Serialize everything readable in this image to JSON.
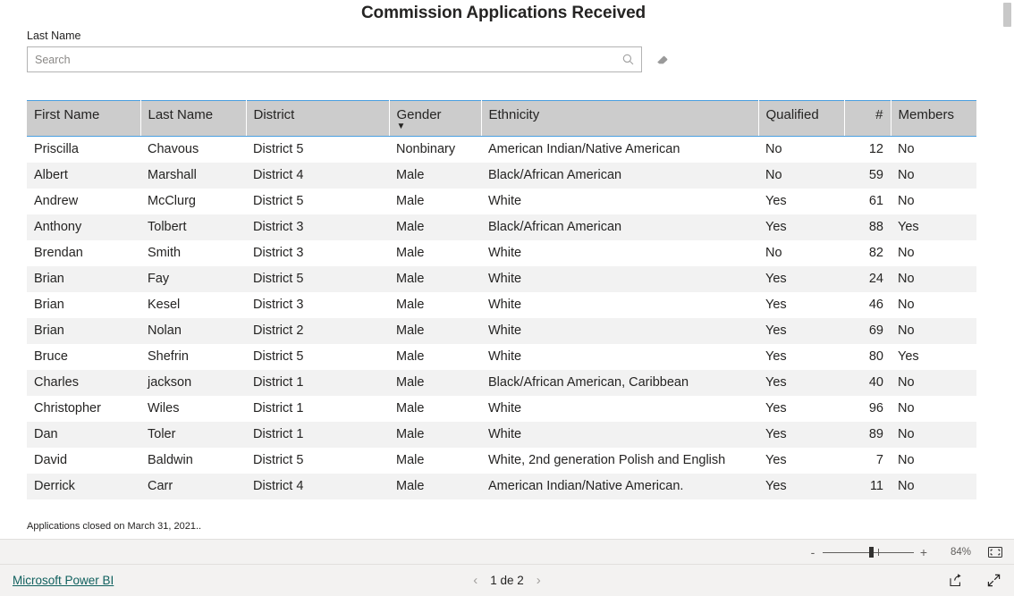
{
  "report": {
    "title": "Commission Applications Received",
    "footnote": "Applications closed on March 31, 2021.."
  },
  "slicer": {
    "label": "Last Name",
    "placeholder": "Search",
    "value": "",
    "search_icon": "search-icon",
    "clear_icon": "eraser-icon"
  },
  "table": {
    "columns": [
      {
        "key": "first_name",
        "label": "First Name",
        "align": "left",
        "sorted": false
      },
      {
        "key": "last_name",
        "label": "Last Name",
        "align": "left",
        "sorted": false
      },
      {
        "key": "district",
        "label": "District",
        "align": "left",
        "sorted": false
      },
      {
        "key": "gender",
        "label": "Gender",
        "align": "left",
        "sorted": true,
        "sort_direction": "desc",
        "sort_glyph": "▼"
      },
      {
        "key": "ethnicity",
        "label": "Ethnicity",
        "align": "left",
        "sorted": false
      },
      {
        "key": "qualified",
        "label": "Qualified",
        "align": "left",
        "sorted": false
      },
      {
        "key": "number",
        "label": "#",
        "align": "right",
        "sorted": false
      },
      {
        "key": "members",
        "label": "Members",
        "align": "left",
        "sorted": false
      }
    ],
    "rows": [
      {
        "first_name": "Priscilla",
        "last_name": "Chavous",
        "district": "District 5",
        "gender": "Nonbinary",
        "ethnicity": "American Indian/Native American",
        "qualified": "No",
        "number": "12",
        "members": "No"
      },
      {
        "first_name": "Albert",
        "last_name": "Marshall",
        "district": "District 4",
        "gender": "Male",
        "ethnicity": "Black/African American",
        "qualified": "No",
        "number": "59",
        "members": "No"
      },
      {
        "first_name": "Andrew",
        "last_name": "McClurg",
        "district": "District 5",
        "gender": "Male",
        "ethnicity": "White",
        "qualified": "Yes",
        "number": "61",
        "members": "No"
      },
      {
        "first_name": "Anthony",
        "last_name": "Tolbert",
        "district": "District 3",
        "gender": "Male",
        "ethnicity": "Black/African American",
        "qualified": "Yes",
        "number": "88",
        "members": "Yes"
      },
      {
        "first_name": "Brendan",
        "last_name": "Smith",
        "district": "District 3",
        "gender": "Male",
        "ethnicity": "White",
        "qualified": "No",
        "number": "82",
        "members": "No"
      },
      {
        "first_name": "Brian",
        "last_name": "Fay",
        "district": "District 5",
        "gender": "Male",
        "ethnicity": "White",
        "qualified": "Yes",
        "number": "24",
        "members": "No"
      },
      {
        "first_name": "Brian",
        "last_name": "Kesel",
        "district": "District 3",
        "gender": "Male",
        "ethnicity": "White",
        "qualified": "Yes",
        "number": "46",
        "members": "No"
      },
      {
        "first_name": "Brian",
        "last_name": "Nolan",
        "district": "District 2",
        "gender": "Male",
        "ethnicity": "White",
        "qualified": "Yes",
        "number": "69",
        "members": "No"
      },
      {
        "first_name": "Bruce",
        "last_name": "Shefrin",
        "district": "District 5",
        "gender": "Male",
        "ethnicity": "White",
        "qualified": "Yes",
        "number": "80",
        "members": "Yes"
      },
      {
        "first_name": "Charles",
        "last_name": "jackson",
        "district": "District 1",
        "gender": "Male",
        "ethnicity": "Black/African American, Caribbean",
        "qualified": "Yes",
        "number": "40",
        "members": "No"
      },
      {
        "first_name": "Christopher",
        "last_name": "Wiles",
        "district": "District 1",
        "gender": "Male",
        "ethnicity": "White",
        "qualified": "Yes",
        "number": "96",
        "members": "No"
      },
      {
        "first_name": "Dan",
        "last_name": "Toler",
        "district": "District 1",
        "gender": "Male",
        "ethnicity": "White",
        "qualified": "Yes",
        "number": "89",
        "members": "No"
      },
      {
        "first_name": "David",
        "last_name": "Baldwin",
        "district": "District 5",
        "gender": "Male",
        "ethnicity": "White, 2nd generation Polish and English",
        "qualified": "Yes",
        "number": "7",
        "members": "No"
      },
      {
        "first_name": "Derrick",
        "last_name": "Carr",
        "district": "District 4",
        "gender": "Male",
        "ethnicity": "American Indian/Native American.",
        "qualified": "Yes",
        "number": "11",
        "members": "No"
      }
    ]
  },
  "zoom_bar": {
    "minus_label": "-",
    "plus_label": "+",
    "percent": "84%",
    "fit_icon": "fit-to-page-icon"
  },
  "bottom_bar": {
    "brand": "Microsoft Power BI",
    "prev_label": "‹",
    "next_label": "›",
    "page_label": "1 de 2",
    "share_icon": "share-icon",
    "fullscreen_icon": "fullscreen-icon"
  },
  "colors": {
    "header_bg": "#cccccc",
    "header_rule": "#4a9fe0",
    "row_alt_bg": "#f2f2f2",
    "brand_link": "#11615f",
    "chrome_bg": "#f3f2f1"
  }
}
